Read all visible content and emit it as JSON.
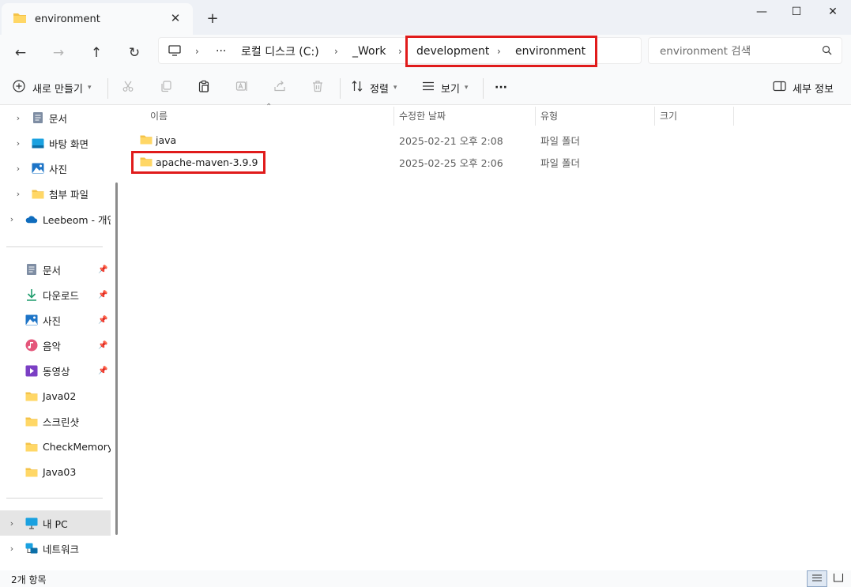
{
  "window": {
    "tab_title": "environment",
    "tab_close_label": "✕",
    "new_tab_label": "+",
    "minimize_label": "—",
    "maximize_label": "☐",
    "close_label": "✕"
  },
  "nav": {
    "back_label": "←",
    "forward_label": "→",
    "up_label": "↑",
    "refresh_label": "↻"
  },
  "breadcrumb": {
    "overflow": "···",
    "items": [
      "로컬 디스크 (C:)",
      "_Work",
      "development",
      "environment"
    ],
    "separator": "›"
  },
  "search": {
    "placeholder": "environment 검색"
  },
  "toolbar": {
    "new_label": "새로 만들기",
    "sort_label": "정렬",
    "view_label": "보기",
    "more_label": "···",
    "details_label": "세부 정보"
  },
  "sidebar": {
    "group1": [
      {
        "label": "문서",
        "icon": "document-icon"
      },
      {
        "label": "바탕 화면",
        "icon": "desktop-icon"
      },
      {
        "label": "사진",
        "icon": "picture-icon"
      },
      {
        "label": "첨부 파일",
        "icon": "folder-icon"
      }
    ],
    "onedrive": {
      "label": "Leebeom - 개인",
      "icon": "cloud-icon"
    },
    "quick_access": [
      {
        "label": "문서",
        "icon": "document-icon",
        "pinned": true
      },
      {
        "label": "다운로드",
        "icon": "download-icon",
        "pinned": true
      },
      {
        "label": "사진",
        "icon": "picture-icon",
        "pinned": true
      },
      {
        "label": "음악",
        "icon": "music-icon",
        "pinned": true
      },
      {
        "label": "동영상",
        "icon": "video-icon",
        "pinned": true
      },
      {
        "label": "Java02",
        "icon": "folder-icon",
        "pinned": false
      },
      {
        "label": "스크린샷",
        "icon": "folder-icon",
        "pinned": false
      },
      {
        "label": "CheckMemory",
        "icon": "folder-icon",
        "pinned": false
      },
      {
        "label": "Java03",
        "icon": "folder-icon",
        "pinned": false
      }
    ],
    "this_pc": {
      "label": "내 PC",
      "icon": "monitor-icon"
    },
    "network": {
      "label": "네트워크",
      "icon": "network-icon"
    }
  },
  "columns": [
    "이름",
    "수정한 날짜",
    "유형",
    "크기"
  ],
  "files": [
    {
      "name": "java",
      "modified": "2025-02-21 오후 2:08",
      "type": "파일 폴더"
    },
    {
      "name": "apache-maven-3.9.9",
      "modified": "2025-02-25 오후 2:06",
      "type": "파일 폴더"
    }
  ],
  "status": {
    "item_count": "2개 항목"
  },
  "colors": {
    "highlight": "#e01b1b",
    "folder": "#f4c34a",
    "accent": "#0067c0"
  }
}
